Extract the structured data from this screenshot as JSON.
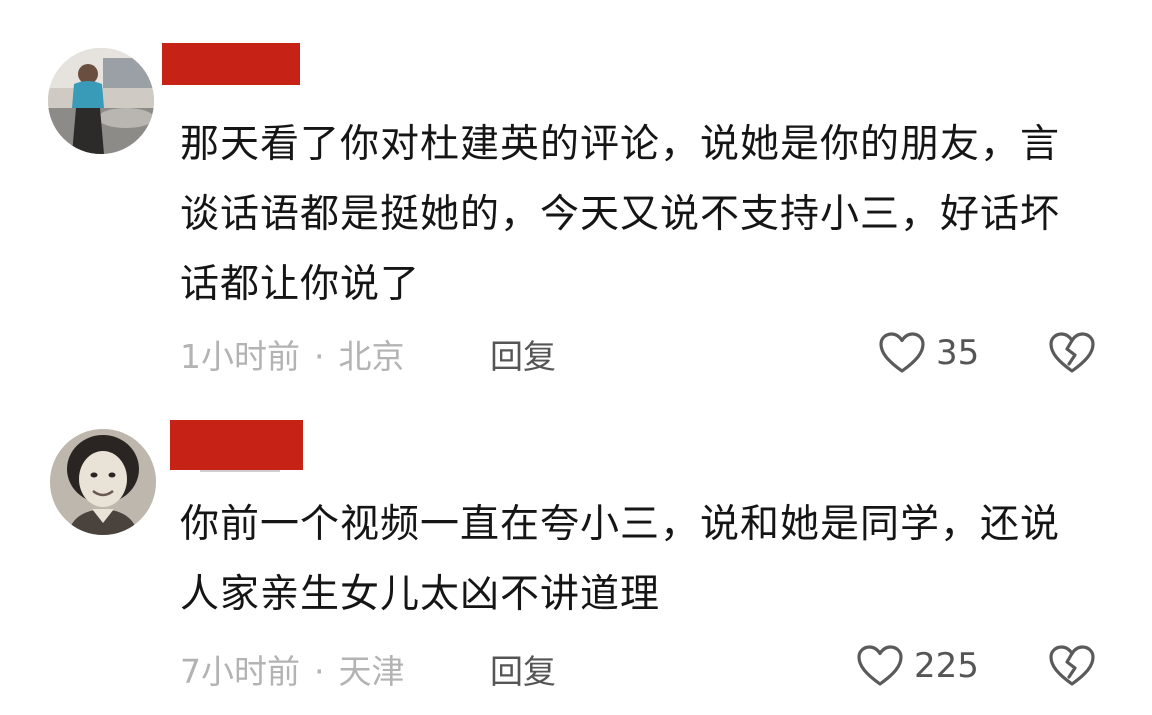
{
  "comments": [
    {
      "text": "那天看了你对杜建英的评论，说她是你的朋友，言谈话语都是挺她的，今天又说不支持小三，好话坏话都让你说了",
      "time": "1小时前",
      "separator": "·",
      "location": "北京",
      "reply_label": "回复",
      "like_count": "35",
      "avatar_icon": "avatar-photo-person-outdoors",
      "username_redacted": true
    },
    {
      "text": "你前一个视频一直在夸小三，说和她是同学，还说人家亲生女儿太凶不讲道理",
      "time": "7小时前",
      "separator": "·",
      "location": "天津",
      "reply_label": "回复",
      "like_count": "225",
      "avatar_icon": "avatar-photo-woman-portrait",
      "username_redacted": true
    }
  ],
  "icons": {
    "like": "heart-outline-icon",
    "dislike": "broken-heart-icon"
  },
  "colors": {
    "redaction": "#c62216",
    "meta_text": "#b3b3b3",
    "action_text": "#555555",
    "body_text": "#151515"
  }
}
